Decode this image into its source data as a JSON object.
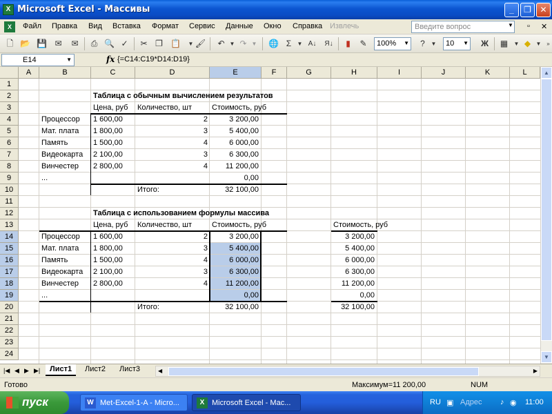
{
  "window": {
    "title": "Microsoft Excel - Массивы"
  },
  "menu": {
    "items": [
      "Файл",
      "Правка",
      "Вид",
      "Вставка",
      "Формат",
      "Сервис",
      "Данные",
      "Окно",
      "Справка",
      "Извлечь"
    ],
    "help_placeholder": "Введите вопрос"
  },
  "toolbar": {
    "zoom": "100%",
    "font_size": "10",
    "bold_label": "Ж"
  },
  "formula_bar": {
    "name_box": "E14",
    "fx_label": "fx",
    "formula": "{=C14:C19*D14:D19}"
  },
  "columns": [
    "A",
    "B",
    "C",
    "D",
    "E",
    "F",
    "G",
    "H",
    "I",
    "J",
    "K",
    "L"
  ],
  "rows": [
    "1",
    "2",
    "3",
    "4",
    "5",
    "6",
    "7",
    "8",
    "9",
    "10",
    "11",
    "12",
    "13",
    "14",
    "15",
    "16",
    "17",
    "18",
    "19",
    "20",
    "21",
    "22",
    "23",
    "24"
  ],
  "table1": {
    "title": "Таблица с обычным вычислением результатов",
    "headers": [
      "Цена, руб",
      "Количество, шт",
      "Стоимость, руб"
    ],
    "rows": [
      {
        "name": "Процессор",
        "price": "1 600,00",
        "qty": "2",
        "cost": "3 200,00"
      },
      {
        "name": "Мат. плата",
        "price": "1 800,00",
        "qty": "3",
        "cost": "5 400,00"
      },
      {
        "name": "Память",
        "price": "1 500,00",
        "qty": "4",
        "cost": "6 000,00"
      },
      {
        "name": "Видеокарта",
        "price": "2 100,00",
        "qty": "3",
        "cost": "6 300,00"
      },
      {
        "name": "Винчестер",
        "price": "2 800,00",
        "qty": "4",
        "cost": "11 200,00"
      },
      {
        "name": "...",
        "price": "",
        "qty": "",
        "cost": "0,00"
      }
    ],
    "total_label": "Итого:",
    "total": "32 100,00"
  },
  "table2": {
    "title": "Таблица с использованием формулы массива",
    "headers": [
      "Цена, руб",
      "Количество, шт",
      "Стоимость, руб"
    ],
    "rows": [
      {
        "name": "Процессор",
        "price": "1 600,00",
        "qty": "2",
        "cost": "3 200,00"
      },
      {
        "name": "Мат. плата",
        "price": "1 800,00",
        "qty": "3",
        "cost": "5 400,00"
      },
      {
        "name": "Память",
        "price": "1 500,00",
        "qty": "4",
        "cost": "6 000,00"
      },
      {
        "name": "Видеокарта",
        "price": "2 100,00",
        "qty": "3",
        "cost": "6 300,00"
      },
      {
        "name": "Винчестер",
        "price": "2 800,00",
        "qty": "4",
        "cost": "11 200,00"
      },
      {
        "name": "...",
        "price": "",
        "qty": "",
        "cost": "0,00"
      }
    ],
    "total_label": "Итого:",
    "total": "32 100,00"
  },
  "side_table": {
    "header": "Стоимость, руб",
    "values": [
      "3 200,00",
      "5 400,00",
      "6 000,00",
      "6 300,00",
      "11 200,00",
      "0,00"
    ],
    "total": "32 100,00"
  },
  "sheet_tabs": [
    "Лист1",
    "Лист2",
    "Лист3"
  ],
  "status": {
    "left": "Готово",
    "sum": "Максимум=11 200,00",
    "mode": "NUM"
  },
  "taskbar": {
    "start": "пуск",
    "buttons": [
      "Met-Excel-1-A - Micro...",
      "Microsoft Excel - Мас..."
    ],
    "lang": "RU",
    "address_label": "Адрес",
    "clock": "11:00"
  },
  "colors": {
    "selection": "#b9cde9",
    "titlebar": "#0a5fd8",
    "taskbar": "#245edb"
  }
}
